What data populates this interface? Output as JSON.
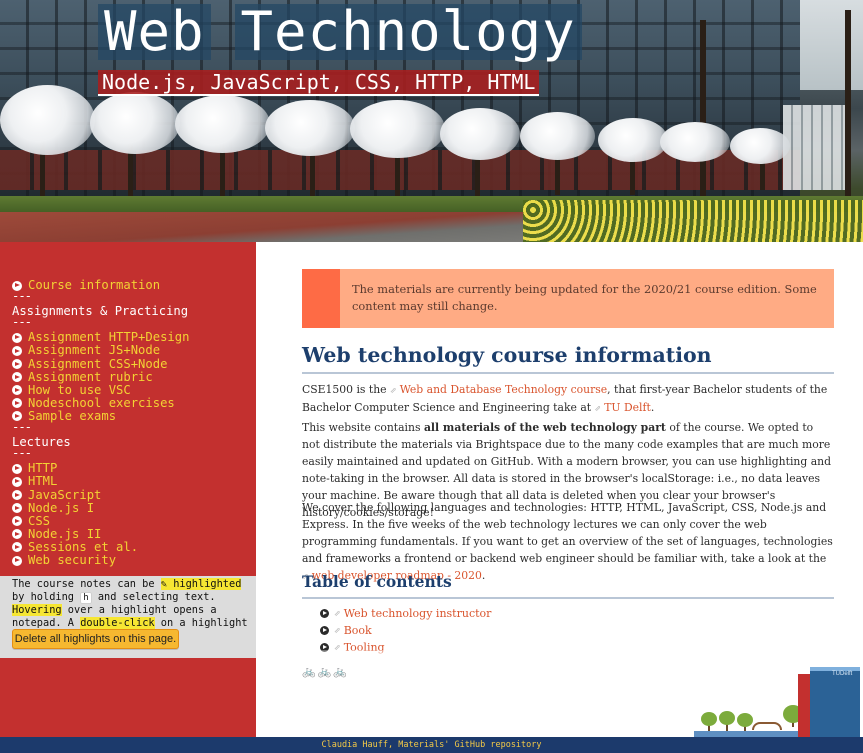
{
  "banner": {
    "title_word_1": "Web",
    "title_word_2": "Technology",
    "subtitle": "Node.js, JavaScript, CSS, HTTP, HTML"
  },
  "sidebar": {
    "course_information": "Course information",
    "separator": "---",
    "assignments_heading": "Assignments & Practicing",
    "assignments": [
      "Assignment HTTP+Design",
      "Assignment JS+Node",
      "Assignment CSS+Node",
      "Assignment rubric",
      "How to use VSC",
      "Nodeschool exercises",
      "Sample exams"
    ],
    "lectures_heading": "Lectures",
    "lectures": [
      "HTTP",
      "HTML",
      "JavaScript",
      "Node.js I",
      "CSS",
      "Node.js II",
      "Sessions et al.",
      "Web security"
    ],
    "notes": {
      "t1": "The course notes can be ",
      "highlighted": "✎ highlighted",
      "t2": " by holding ",
      "key": "h",
      "t3": " and selecting text. ",
      "hovering": "Hovering",
      "t4": " over a highlight opens a notepad. A ",
      "double_click": "double-click",
      "t5": " on a highlight removes it."
    },
    "delete_button": "Delete all highlights on this page."
  },
  "main": {
    "notice": "The materials are currently being updated for the 2020/21 course edition. Some content may still change.",
    "heading": "Web technology course information",
    "para1": {
      "t1": "CSE1500 is the ",
      "link1": "Web and Database Technology course",
      "t2": ", that first-year Bachelor students of the Bachelor Computer Science and Engineering take at ",
      "link2": "TU Delft",
      "t3": "."
    },
    "para2": {
      "t1": "This website contains ",
      "bold": "all materials of the web technology part",
      "t2": " of the course. We opted to not distribute the materials via Brightspace due to the many code examples that are much more easily maintained and updated on GitHub. With a modern browser, you can use highlighting and note-taking in the browser. All data is stored in the browser's localStorage: i.e., no data leaves your machine. Be aware though that all data is deleted when you clear your browser's history/cookies/storage!"
    },
    "para3": {
      "t1": "We cover the following languages and technologies: HTTP, HTML, JavaScript, CSS, Node.js and Express. In the five weeks of the web technology lectures we can only cover the web programming fundamentals. If you want to get an overview of the set of languages, technologies and frameworks a frontend or backend web engineer should be familiar with, take a look at the ",
      "link": "web developer roadmap - 2020",
      "t2": "."
    },
    "toc_heading": "Table of contents",
    "toc": [
      "Web technology instructor",
      "Book",
      "Tooling"
    ],
    "link_glyph": "⇗",
    "bikes": "🚲🚲🚲",
    "illustration_label": "TUDelft"
  },
  "footer": {
    "text": "Claudia Hauff, Materials' GitHub repository"
  },
  "colors": {
    "sidebar_red": "#c3302f",
    "nav_yellow": "#f3d234",
    "heading_blue": "#1d3f6d",
    "link_orange": "#d9542d",
    "notice_bg": "#ffab84",
    "notice_bar": "#fe6b45",
    "footer_blue": "#1c3a6c"
  }
}
